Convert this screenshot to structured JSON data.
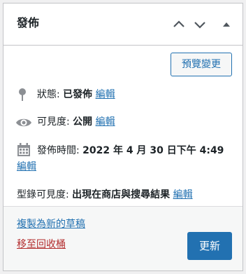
{
  "box": {
    "title": "發佈",
    "icons": [
      "chevron-up-icon",
      "chevron-down-icon",
      "toggle-triangle-icon"
    ]
  },
  "actions": {
    "preview_label": "預覽變更"
  },
  "status": {
    "label": "狀態: ",
    "value": "已發佈",
    "edit": "編輯",
    "icon": "pin-icon"
  },
  "visibility": {
    "label": "可見度: ",
    "value": "公開",
    "edit": "編輯",
    "icon": "eye-icon"
  },
  "publish_time": {
    "label": "發佈時間: ",
    "value": "2022 年 4 月 30 日下午 4:49",
    "edit": "編輯",
    "icon": "calendar-icon"
  },
  "catalog": {
    "label": "型錄可見度: ",
    "value": "出現在商店與搜尋結果",
    "edit": "編輯"
  },
  "footer": {
    "copy_label": "複製為新的草稿",
    "trash_label": "移至回收桶",
    "update_label": "更新"
  },
  "colors": {
    "accent": "#2271b1",
    "danger": "#b32d2e",
    "border": "#c3c4c7",
    "footer_bg": "#f6f7f7"
  }
}
